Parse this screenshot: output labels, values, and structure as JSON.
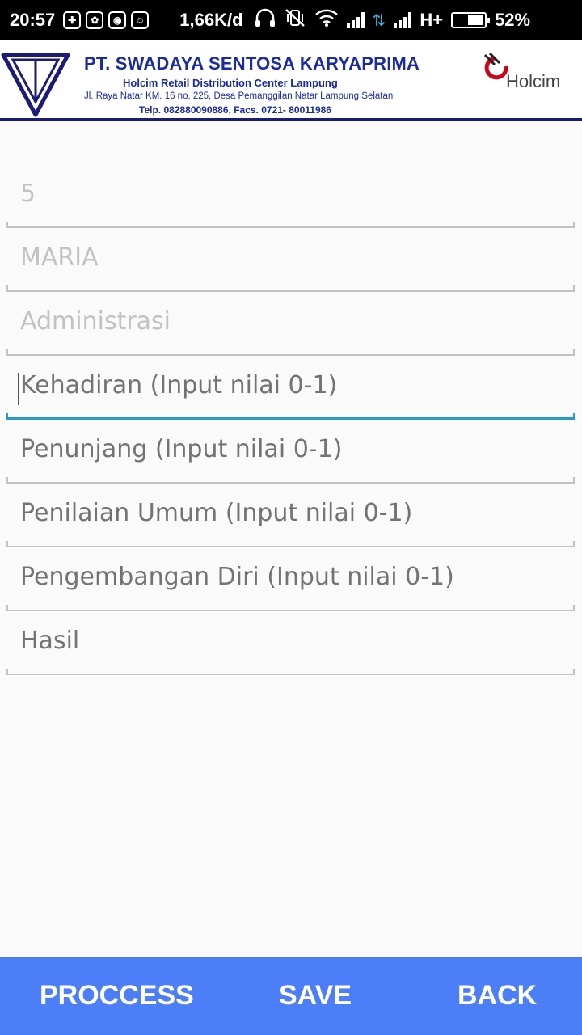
{
  "status_bar": {
    "time": "20:57",
    "net_speed": "1,66K/d",
    "network_type": "H+",
    "battery": "52%",
    "battery_level": 0.52,
    "icons": [
      "shield-icon",
      "shield-icon",
      "app-icon",
      "android-icon",
      "headphones-icon",
      "vibrate-off-icon",
      "wifi-icon",
      "signal-icon",
      "data-arrows-icon",
      "signal-icon"
    ]
  },
  "header": {
    "company_name": "PT. SWADAYA SENTOSA KARYAPRIMA",
    "subtitle": "Holcim Retail Distribution Center Lampung",
    "address": "Jl. Raya Natar KM. 16 no. 225, Desa Pemanggilan Natar Lampung Selatan",
    "phone": "Telp. 082880090886, Facs. 0721- 80011986",
    "brand": "Holcim"
  },
  "form": {
    "id_value": "5",
    "name_value": "MARIA",
    "department_value": "Administrasi",
    "kehadiran_placeholder": "Kehadiran (Input nilai 0-1)",
    "penunjang_placeholder": "Penunjang (Input nilai 0-1)",
    "penilaian_placeholder": "Penilaian Umum (Input nilai 0-1)",
    "pengembangan_placeholder": "Pengembangan Diri (Input nilai 0-1)",
    "hasil_placeholder": "Hasil"
  },
  "buttons": {
    "process": "PROCCESS",
    "save": "SAVE",
    "back": "BACK"
  },
  "colors": {
    "header_text": "#1b2aa6",
    "focus_line": "#2a9bc7",
    "bottom_bar": "#4c7ef7"
  }
}
